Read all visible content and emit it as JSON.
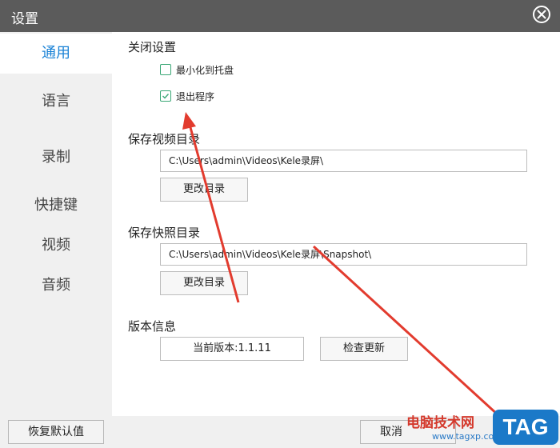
{
  "window": {
    "title": "设置"
  },
  "sidebar": {
    "items": [
      {
        "label": "通用",
        "active": true
      },
      {
        "label": "语言",
        "active": false
      },
      {
        "label": "录制",
        "active": false
      },
      {
        "label": "快捷键",
        "active": false
      },
      {
        "label": "视频",
        "active": false
      },
      {
        "label": "音频",
        "active": false
      }
    ]
  },
  "close_settings": {
    "title": "关闭设置",
    "options": [
      {
        "label": "最小化到托盘",
        "checked": false
      },
      {
        "label": "退出程序",
        "checked": true
      }
    ]
  },
  "video_dir": {
    "title": "保存视频目录",
    "path": "C:\\Users\\admin\\Videos\\Kele录屏\\",
    "button": "更改目录"
  },
  "snapshot_dir": {
    "title": "保存快照目录",
    "path": "C:\\Users\\admin\\Videos\\Kele录屏\\Snapshot\\",
    "button": "更改目录"
  },
  "version": {
    "title": "版本信息",
    "current": "当前版本:1.1.11",
    "check_button": "检查更新"
  },
  "footer": {
    "restore_button": "恢复默认值",
    "cancel_button": "取消"
  },
  "watermark": {
    "site_name": "电脑技术网",
    "url": "www.tagxp.com",
    "tag": "TAG"
  },
  "colors": {
    "titlebar": "#5b5b5b",
    "accent": "#1a82d6",
    "checkbox": "#3aa776",
    "annotation_arrow": "#e23b2e"
  }
}
